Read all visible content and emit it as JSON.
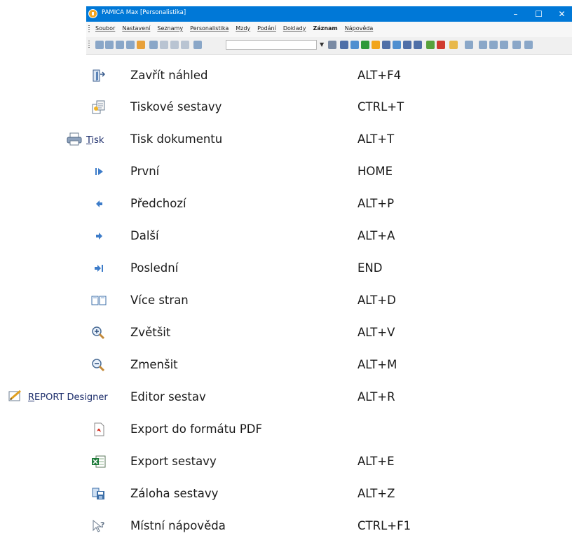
{
  "window": {
    "title": "PAMICA Max  [Personalistika]",
    "controls": {
      "minimize": "–",
      "maximize": "☐",
      "close": "✕"
    }
  },
  "menu": [
    {
      "label": "Soubor"
    },
    {
      "label": "Nastavení"
    },
    {
      "label": "Seznamy"
    },
    {
      "label": "Personalistika"
    },
    {
      "label": "Mzdy"
    },
    {
      "label": "Podání"
    },
    {
      "label": "Doklady"
    },
    {
      "label": "Záznam",
      "active": true
    },
    {
      "label": "Nápověda"
    }
  ],
  "toolbar_accent": "#0078d7",
  "tisk_button": {
    "label": "Tisk",
    "underlined_char": "T"
  },
  "report_button": {
    "label": "REPORT Designer",
    "underlined_char": "R"
  },
  "shortcuts": [
    {
      "icon": "close-preview-icon",
      "label": "Zavřít náhled",
      "key": "ALT+F4"
    },
    {
      "icon": "report-sets-icon",
      "label": "Tiskové sestavy",
      "key": "CTRL+T"
    },
    {
      "icon": "printer-icon",
      "label": "Tisk dokumentu",
      "key": "ALT+T"
    },
    {
      "icon": "first-page-icon",
      "label": "První",
      "key": "HOME"
    },
    {
      "icon": "previous-page-icon",
      "label": "Předchozí",
      "key": "ALT+P"
    },
    {
      "icon": "next-page-icon",
      "label": "Další",
      "key": "ALT+A"
    },
    {
      "icon": "last-page-icon",
      "label": "Poslední",
      "key": "END"
    },
    {
      "icon": "multiple-pages-icon",
      "label": "Více stran",
      "key": "ALT+D"
    },
    {
      "icon": "zoom-in-icon",
      "label": "Zvětšit",
      "key": "ALT+V"
    },
    {
      "icon": "zoom-out-icon",
      "label": "Zmenšit",
      "key": "ALT+M"
    },
    {
      "icon": "report-designer-icon",
      "label": "Editor sestav",
      "key": "ALT+R"
    },
    {
      "icon": "pdf-export-icon",
      "label": "Export do formátu PDF",
      "key": ""
    },
    {
      "icon": "excel-export-icon",
      "label": "Export sestavy",
      "key": "ALT+E"
    },
    {
      "icon": "backup-report-icon",
      "label": "Záloha sestavy",
      "key": "ALT+Z"
    },
    {
      "icon": "context-help-icon",
      "label": "Místní nápověda",
      "key": "CTRL+F1"
    }
  ]
}
